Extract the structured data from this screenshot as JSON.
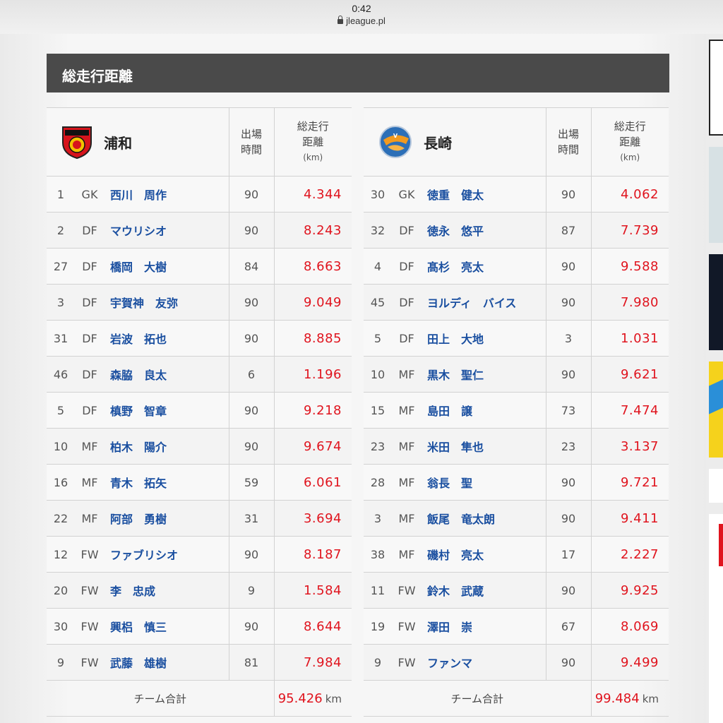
{
  "browser": {
    "time": "0:42",
    "url": "jleague.pl"
  },
  "section_title": "総走行距離",
  "headers": {
    "minutes": [
      "出場",
      "時間"
    ],
    "distance": [
      "総走行",
      "距離"
    ],
    "distance_unit": "(km)"
  },
  "teams": [
    {
      "name": "浦和",
      "crest_icon": "urawa-reds-crest-icon",
      "players": [
        {
          "no": "1",
          "pos": "GK",
          "name": "西川　周作",
          "min": "90",
          "dist": "4.344"
        },
        {
          "no": "2",
          "pos": "DF",
          "name": "マウリシオ",
          "min": "90",
          "dist": "8.243"
        },
        {
          "no": "27",
          "pos": "DF",
          "name": "橋岡　大樹",
          "min": "84",
          "dist": "8.663"
        },
        {
          "no": "3",
          "pos": "DF",
          "name": "宇賀神　友弥",
          "min": "90",
          "dist": "9.049"
        },
        {
          "no": "31",
          "pos": "DF",
          "name": "岩波　拓也",
          "min": "90",
          "dist": "8.885"
        },
        {
          "no": "46",
          "pos": "DF",
          "name": "森脇　良太",
          "min": "6",
          "dist": "1.196"
        },
        {
          "no": "5",
          "pos": "DF",
          "name": "槙野　智章",
          "min": "90",
          "dist": "9.218"
        },
        {
          "no": "10",
          "pos": "MF",
          "name": "柏木　陽介",
          "min": "90",
          "dist": "9.674"
        },
        {
          "no": "16",
          "pos": "MF",
          "name": "青木　拓矢",
          "min": "59",
          "dist": "6.061"
        },
        {
          "no": "22",
          "pos": "MF",
          "name": "阿部　勇樹",
          "min": "31",
          "dist": "3.694"
        },
        {
          "no": "12",
          "pos": "FW",
          "name": "ファブリシオ",
          "min": "90",
          "dist": "8.187"
        },
        {
          "no": "20",
          "pos": "FW",
          "name": "李　忠成",
          "min": "9",
          "dist": "1.584"
        },
        {
          "no": "30",
          "pos": "FW",
          "name": "興梠　慎三",
          "min": "90",
          "dist": "8.644"
        },
        {
          "no": "9",
          "pos": "FW",
          "name": "武藤　雄樹",
          "min": "81",
          "dist": "7.984"
        }
      ],
      "total_label": "チーム合計",
      "total": "95.426",
      "total_unit": "km"
    },
    {
      "name": "長崎",
      "crest_icon": "v-varen-nagasaki-crest-icon",
      "players": [
        {
          "no": "30",
          "pos": "GK",
          "name": "徳重　健太",
          "min": "90",
          "dist": "4.062"
        },
        {
          "no": "32",
          "pos": "DF",
          "name": "徳永　悠平",
          "min": "87",
          "dist": "7.739"
        },
        {
          "no": "4",
          "pos": "DF",
          "name": "髙杉　亮太",
          "min": "90",
          "dist": "9.588"
        },
        {
          "no": "45",
          "pos": "DF",
          "name": "ヨルディ　バイス",
          "min": "90",
          "dist": "7.980"
        },
        {
          "no": "5",
          "pos": "DF",
          "name": "田上　大地",
          "min": "3",
          "dist": "1.031"
        },
        {
          "no": "10",
          "pos": "MF",
          "name": "黒木　聖仁",
          "min": "90",
          "dist": "9.621"
        },
        {
          "no": "15",
          "pos": "MF",
          "name": "島田　譲",
          "min": "73",
          "dist": "7.474"
        },
        {
          "no": "23",
          "pos": "MF",
          "name": "米田　隼也",
          "min": "23",
          "dist": "3.137"
        },
        {
          "no": "28",
          "pos": "MF",
          "name": "翁長　聖",
          "min": "90",
          "dist": "9.721"
        },
        {
          "no": "3",
          "pos": "MF",
          "name": "飯尾　竜太朗",
          "min": "90",
          "dist": "9.411"
        },
        {
          "no": "38",
          "pos": "MF",
          "name": "磯村　亮太",
          "min": "17",
          "dist": "2.227"
        },
        {
          "no": "11",
          "pos": "FW",
          "name": "鈴木　武蔵",
          "min": "90",
          "dist": "9.925"
        },
        {
          "no": "19",
          "pos": "FW",
          "name": "澤田　崇",
          "min": "67",
          "dist": "8.069"
        },
        {
          "no": "9",
          "pos": "FW",
          "name": "ファンマ",
          "min": "90",
          "dist": "9.499"
        }
      ],
      "total_label": "チーム合計",
      "total": "99.484",
      "total_unit": "km"
    }
  ],
  "colors": {
    "header_bg": "#4a4a4a",
    "player_link": "#1a4fa0",
    "distance": "#e0141e"
  }
}
